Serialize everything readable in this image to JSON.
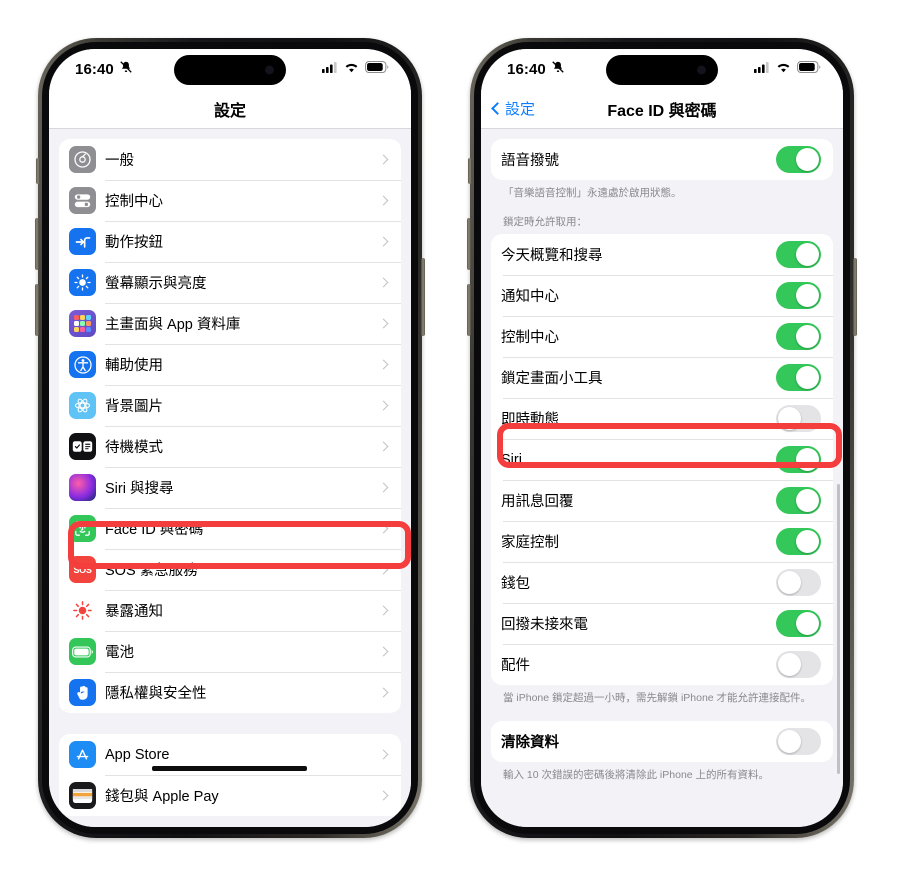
{
  "meta": {
    "accent_red": "#f43d3d",
    "ios_blue": "#0a7cff",
    "toggle_on": "#34c759",
    "toggle_off": "#e4e4e7"
  },
  "statusbar": {
    "time": "16:40",
    "silent_icon": "bell-slash-icon",
    "cellular_icon": "cellular-bars-icon",
    "wifi_icon": "wifi-icon",
    "battery_icon": "battery-icon"
  },
  "left_phone": {
    "nav": {
      "title": "設定"
    },
    "groups": [
      {
        "rows": [
          {
            "label": "一般",
            "icon": "gear-icon"
          },
          {
            "label": "控制中心",
            "icon": "control-center-icon"
          },
          {
            "label": "動作按鈕",
            "icon": "action-button-icon"
          },
          {
            "label": "螢幕顯示與亮度",
            "icon": "brightness-icon"
          },
          {
            "label": "主畫面與 App 資料庫",
            "icon": "home-screen-icon"
          },
          {
            "label": "輔助使用",
            "icon": "accessibility-icon"
          },
          {
            "label": "背景圖片",
            "icon": "wallpaper-icon"
          },
          {
            "label": "待機模式",
            "icon": "standby-icon"
          },
          {
            "label": "Siri 與搜尋",
            "icon": "siri-icon"
          },
          {
            "label": "Face ID 與密碼",
            "icon": "face-id-icon",
            "highlighted": true
          },
          {
            "label": "SOS 緊急服務",
            "icon": "sos-icon"
          },
          {
            "label": "暴露通知",
            "icon": "exposure-notification-icon"
          },
          {
            "label": "電池",
            "icon": "battery-settings-icon"
          },
          {
            "label": "隱私權與安全性",
            "icon": "privacy-icon"
          }
        ]
      },
      {
        "rows": [
          {
            "label": "App Store",
            "icon": "app-store-icon"
          },
          {
            "label": "錢包與 Apple Pay",
            "icon": "wallet-icon",
            "censored": true
          }
        ]
      }
    ]
  },
  "right_phone": {
    "nav": {
      "back_label": "設定",
      "title": "Face ID 與密碼",
      "back_icon": "chevron-left-icon"
    },
    "top_group": {
      "rows": [
        {
          "label": "語音撥號",
          "on": true
        }
      ]
    },
    "top_footnote": "「音樂語音控制」永遠處於啟用狀態。",
    "section_header": "鎖定時允許取用：",
    "allow_group": {
      "rows": [
        {
          "label": "今天概覽和搜尋",
          "on": true
        },
        {
          "label": "通知中心",
          "on": true
        },
        {
          "label": "控制中心",
          "on": true
        },
        {
          "label": "鎖定畫面小工具",
          "on": true
        },
        {
          "label": "即時動態",
          "on": false,
          "highlighted": true
        },
        {
          "label": "Siri",
          "on": true
        },
        {
          "label": "用訊息回覆",
          "on": true
        },
        {
          "label": "家庭控制",
          "on": true
        },
        {
          "label": "錢包",
          "on": false
        },
        {
          "label": "回撥未接來電",
          "on": true
        },
        {
          "label": "配件",
          "on": false
        }
      ]
    },
    "accessory_footnote": "當 iPhone 鎖定超過一小時，需先解鎖 iPhone 才能允許連接配件。",
    "erase_group": {
      "rows": [
        {
          "label": "清除資料",
          "on": false
        }
      ]
    },
    "erase_footnote": "輸入 10 次錯誤的密碼後將清除此 iPhone 上的所有資料。"
  }
}
